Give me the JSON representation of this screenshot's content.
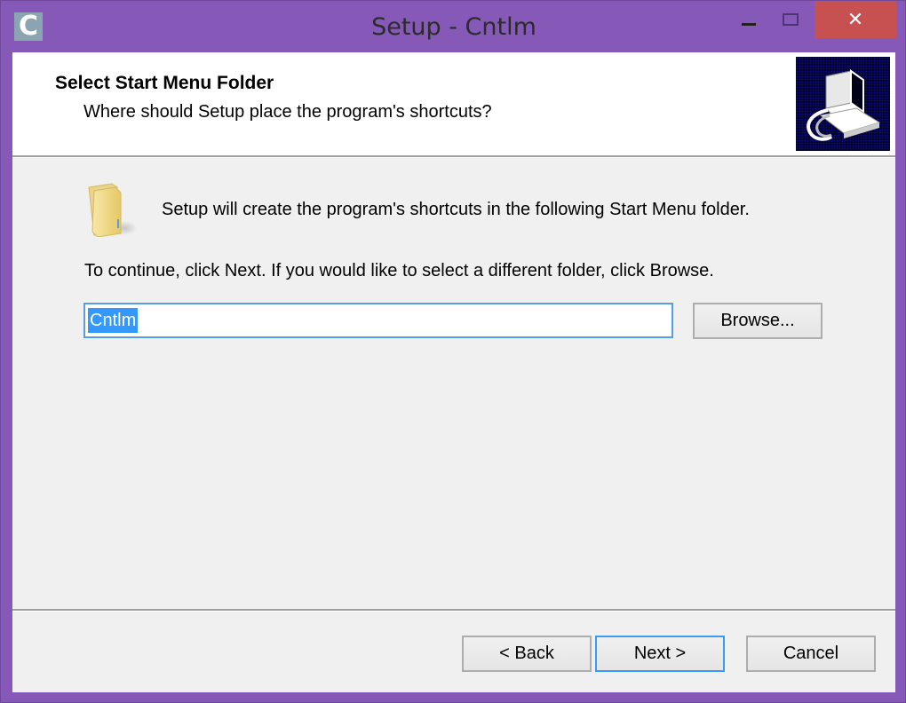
{
  "window": {
    "title": "Setup - Cntlm",
    "app_icon_letter": "C",
    "controls": {
      "minimize": "minimize-icon",
      "maximize": "maximize-icon",
      "close_glyph": "✕"
    },
    "colors": {
      "frame": "#8659b8",
      "close_button": "#c75050",
      "selection": "#3399ff",
      "focus_border": "#3c9af0"
    }
  },
  "header": {
    "title": "Select Start Menu Folder",
    "subtitle": "Where should Setup place the program's shortcuts?",
    "image": "computer-setup-icon"
  },
  "body": {
    "folder_icon": "folder-icon",
    "intro": "Setup will create the program's shortcuts in the following Start Menu folder.",
    "instructions": "To continue, click Next. If you would like to select a different folder, click Browse.",
    "folder_field": {
      "value": "Cntlm",
      "selected": true
    },
    "browse_label": "Browse..."
  },
  "footer": {
    "back_label": "< Back",
    "next_label": "Next >",
    "cancel_label": "Cancel",
    "default_button": "next"
  }
}
